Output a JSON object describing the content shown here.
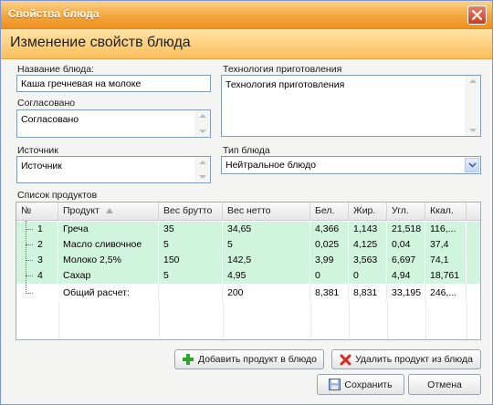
{
  "window": {
    "title": "Свойства блюда"
  },
  "header": {
    "title": "Изменение свойств блюда"
  },
  "form": {
    "name_label": "Название блюда:",
    "name_value": "Каша гречневая на молоке",
    "agreed_label": "Согласовано",
    "agreed_value": "Согласовано",
    "source_label": "Источник",
    "source_value": "Источник",
    "tech_label": "Технология приготовления",
    "tech_value": "Технология приготовления",
    "type_label": "Тип блюда",
    "type_value": "Нейтральное блюдо"
  },
  "products": {
    "label": "Список продуктов",
    "columns": [
      "№",
      "Продукт",
      "Вес брутто",
      "Вес нетто",
      "Бел.",
      "Жир.",
      "Угл.",
      "Ккал."
    ],
    "rows": [
      {
        "num": "1",
        "product": "Греча",
        "brutto": "35",
        "netto": "34,65",
        "prot": "4,366",
        "fat": "1,143",
        "carb": "21,518",
        "kcal": "116,..."
      },
      {
        "num": "2",
        "product": "Масло сливочное",
        "brutto": "5",
        "netto": "5",
        "prot": "0,025",
        "fat": "4,125",
        "carb": "0,04",
        "kcal": "37,4"
      },
      {
        "num": "3",
        "product": "Молоко 2,5%",
        "brutto": "150",
        "netto": "142,5",
        "prot": "3,99",
        "fat": "3,563",
        "carb": "6,697",
        "kcal": "74,1"
      },
      {
        "num": "4",
        "product": "Сахар",
        "brutto": "5",
        "netto": "4,95",
        "prot": "0",
        "fat": "0",
        "carb": "4,94",
        "kcal": "18,761"
      }
    ],
    "total": {
      "product": "Общий расчет:",
      "brutto": "",
      "netto": "200",
      "prot": "8,381",
      "fat": "8,831",
      "carb": "33,195",
      "kcal": "246,..."
    }
  },
  "buttons": {
    "add_product": "Добавить продукт в блюдо",
    "remove_product": "Удалить продукт из блюда",
    "save": "Сохранить",
    "cancel": "Отмена"
  },
  "colors": {
    "title_bar": "#f4a53d",
    "header_band": "#fbbe5a",
    "row_highlight": "#d1f4df"
  },
  "icons": [
    "close-icon",
    "sort-asc-icon",
    "add-icon",
    "delete-icon",
    "save-icon",
    "dropdown-arrow-icon"
  ]
}
